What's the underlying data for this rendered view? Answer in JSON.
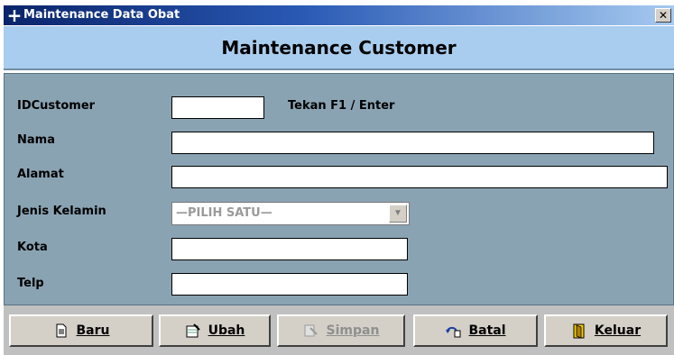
{
  "window": {
    "title": "Maintenance Data Obat",
    "close_glyph": "✕",
    "app_icon": "plus-icon"
  },
  "header": {
    "title": "Maintenance Customer"
  },
  "form": {
    "idcustomer_label": "IDCustomer",
    "idcustomer_value": "",
    "hint": "Tekan F1 / Enter",
    "nama_label": "Nama",
    "nama_value": "",
    "alamat_label": "Alamat",
    "alamat_value": "",
    "jenis_label": "Jenis Kelamin",
    "jenis_selected": "—PILIH SATU—",
    "kota_label": "Kota",
    "kota_value": "",
    "telp_label": "Telp",
    "telp_value": ""
  },
  "buttons": {
    "baru": "Baru",
    "ubah": "Ubah",
    "simpan": "Simpan",
    "batal": "Batal",
    "keluar": "Keluar"
  },
  "colors": {
    "panel": "#8aa3b3",
    "header": "#a9cdee",
    "titlebar": "#0a246a"
  }
}
